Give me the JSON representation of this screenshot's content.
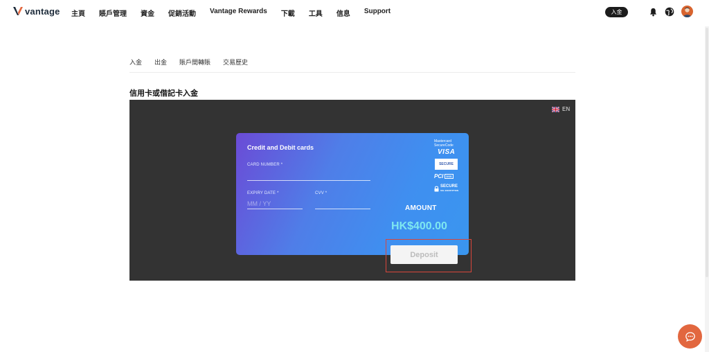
{
  "header": {
    "logo_text": "vantage",
    "nav": [
      "主頁",
      "賬戶管理",
      "資金",
      "促銷活動",
      "Vantage Rewards",
      "下載",
      "工具",
      "信息",
      "Support"
    ],
    "deposit_pill": "入金",
    "icons": [
      "bell-icon",
      "globe-icon",
      "avatar"
    ]
  },
  "tabs": [
    "入金",
    "出金",
    "賬戶間轉賬",
    "交易歷史"
  ],
  "section_title": "信用卡或借記卡入金",
  "language": {
    "flag": "uk-flag-icon",
    "label": "EN"
  },
  "card_form": {
    "title": "Credit and Debit cards",
    "card_number_label": "CARD NUMBER *",
    "card_number_value": "",
    "expiry_label": "EXPIRY DATE *",
    "expiry_placeholder": "MM / YY",
    "cvv_label": "CVV *",
    "cvv_value": "",
    "amount_label": "AMOUNT",
    "amount_value": "HK$400.00",
    "deposit_button": "Deposit"
  },
  "badges": {
    "mastercard": "Mastercard SecureCode",
    "visa": "VISA",
    "secure": "SECURE",
    "pci": "PCI",
    "pci_sub": "DSS",
    "ssl": "SECURE",
    "ssl_sub": "SSL ENCRYPTION"
  },
  "colors": {
    "accent_highlight": "#d9463a",
    "amount_color": "#7ee7f0",
    "panel_bg": "#333333",
    "chat_button": "#e2673f"
  }
}
